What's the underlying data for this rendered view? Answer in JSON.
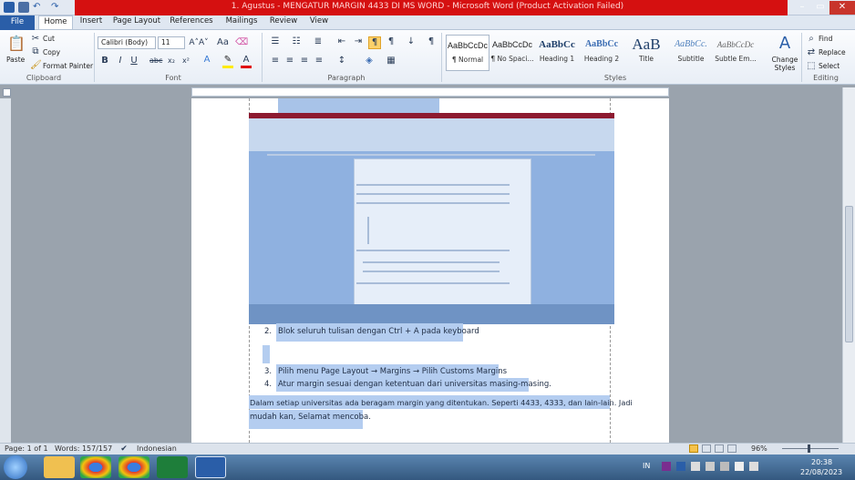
{
  "window": {
    "title": "1. Agustus - MENGATUR MARGIN 4433 DI MS WORD - Microsoft Word (Product Activation Failed)"
  },
  "tabs": [
    "File",
    "Home",
    "Insert",
    "Page Layout",
    "References",
    "Mailings",
    "Review",
    "View"
  ],
  "clipboard": {
    "paste": "Paste",
    "cut": "Cut",
    "copy": "Copy",
    "format_painter": "Format Painter",
    "label": "Clipboard"
  },
  "font": {
    "name": "Calibri (Body)",
    "size": "11",
    "label": "Font"
  },
  "paragraph": {
    "label": "Paragraph"
  },
  "styles": {
    "items": [
      {
        "preview": "AaBbCcDc",
        "name": "¶ Normal"
      },
      {
        "preview": "AaBbCcDc",
        "name": "¶ No Spaci..."
      },
      {
        "preview": "AaBbCc",
        "name": "Heading 1"
      },
      {
        "preview": "AaBbCc",
        "name": "Heading 2"
      },
      {
        "preview": "AaB",
        "name": "Title"
      },
      {
        "preview": "AaBbCc.",
        "name": "Subtitle"
      },
      {
        "preview": "AaBbCcDc",
        "name": "Subtle Em..."
      }
    ],
    "change": "Change Styles",
    "label": "Styles"
  },
  "editing": {
    "find": "Find",
    "replace": "Replace",
    "select": "Select",
    "label": "Editing"
  },
  "document": {
    "step2": "Blok seluruh tulisan dengan Ctrl + A pada keyboard",
    "n2": "2.",
    "step3": "Pilih menu Page Layout → Margins → Pilih Customs Margins",
    "n3": "3.",
    "step4": "Atur margin sesuai dengan ketentuan dari universitas masing-masing.",
    "n4": "4.",
    "closing1": "Dalam setiap universitas ada beragam margin yang ditentukan. Seperti 4433, 4333, dan lain-lain. Jadi",
    "closing2": "mudah kan, Selamat mencoba."
  },
  "statusbar": {
    "page": "Page: 1 of 1",
    "words": "Words: 157/157",
    "language": "Indonesian",
    "zoom": "96%"
  },
  "taskbar": {
    "lang": "IN",
    "time": "20:38",
    "date": "22/08/2023"
  }
}
